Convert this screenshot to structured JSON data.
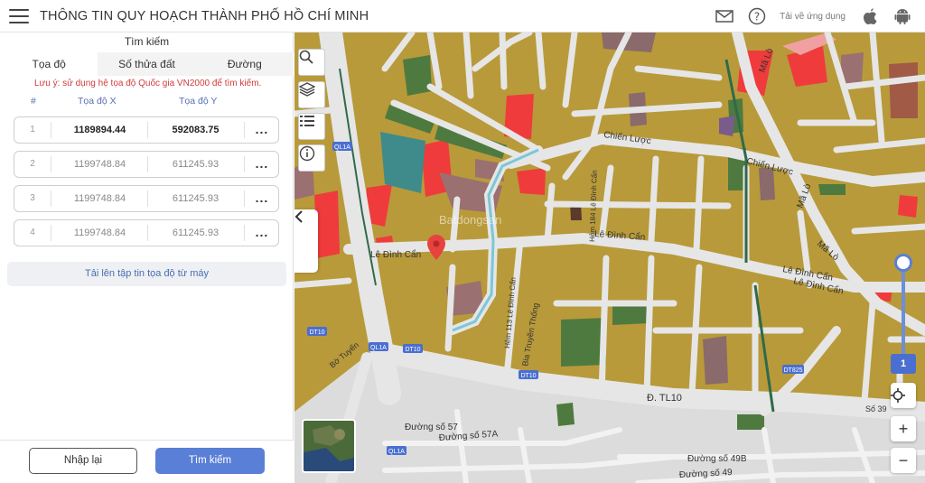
{
  "header": {
    "title": "THÔNG TIN QUY HOẠCH THÀNH PHỐ HỒ CHÍ MINH",
    "download_label": "Tải về ứng dụng",
    "icons": [
      "mail-icon",
      "help-icon",
      "apple-icon",
      "android-icon"
    ]
  },
  "panel": {
    "title": "Tìm kiếm",
    "tabs": [
      {
        "label": "Tọa độ",
        "active": true
      },
      {
        "label": "Số thửa đất",
        "active": false
      },
      {
        "label": "Đường",
        "active": false
      }
    ],
    "warning": "Lưu ý: sử dụng hệ tọa độ Quốc gia VN2000 để tìm kiếm.",
    "columns": {
      "num": "#",
      "x": "Tọa độ X",
      "y": "Tọa độ Y"
    },
    "rows": [
      {
        "num": "1",
        "x": "1189894.44",
        "y": "592083.75"
      },
      {
        "num": "2",
        "x": "1199748.84",
        "y": "611245.93"
      },
      {
        "num": "3",
        "x": "1199748.84",
        "y": "611245.93"
      },
      {
        "num": "4",
        "x": "1199748.84",
        "y": "611245.93"
      }
    ],
    "more_label": "...",
    "upload_label": "Tải lên tập tin tọa độ từ máy",
    "reset_label": "Nhập lại",
    "search_label": "Tìm kiếm"
  },
  "map": {
    "zoom_level": "1",
    "zoom_in": "+",
    "zoom_out": "−",
    "labels": {
      "chien_luoc": "Chiến Lược",
      "chien_luoc_2": "Chiến Lược",
      "le_dinh_can_1": "Lê Đình Cẩn",
      "le_dinh_can_2": "Lê Đình Cẩn",
      "le_dinh_can_3": "Lê Đình Cẩn",
      "le_dinh_can_4": "Lê Đình Cẩn",
      "ma_lo_1": "Mã Lò",
      "ma_lo_2": "Mã Lò",
      "ma_lo_3": "Mã Lò",
      "tl10": "Đ. TL10",
      "duong_57": "Đường số 57",
      "duong_57a": "Đường số 57A",
      "duong_49b": "Đường số 49B",
      "duong_49": "Đường số 49",
      "bia_truyen_thong": "Bia Truyền Thống",
      "hem_184": "Hẻm 184 Lê Đình Cẩn",
      "hem_113": "Hẻm 113 Lê Đình Cẩn",
      "so_39": "Số 39",
      "dt10_1": "DT10",
      "dt10_2": "DT10",
      "dt10_3": "DT10",
      "ql1a_1": "QL1A",
      "ql1a_2": "QL1A",
      "ql1a_3": "QL1A",
      "dt825": "DT825",
      "bo_tuyen": "Bờ Tuyến",
      "watermark": "Batdongsan"
    }
  },
  "colors": {
    "accent": "#5a7fd6",
    "warning": "#d23b3b",
    "land_residential": "#b89a3a",
    "land_green": "#4f7a3f",
    "land_red": "#ef3b3b",
    "land_mauve": "#8a6a6a",
    "road": "#e6e6e6"
  }
}
